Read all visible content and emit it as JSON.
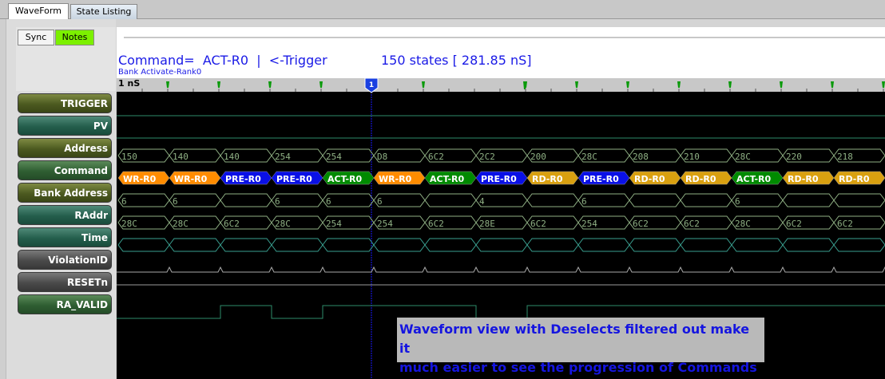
{
  "tabs": [
    {
      "label": "WaveForm",
      "active": true
    },
    {
      "label": "State Listing",
      "active": false
    }
  ],
  "toolbar": {
    "sync_label": "Sync",
    "notes_label": "Notes",
    "notes_color": "#7cf000"
  },
  "header": {
    "command_label": "Command=",
    "command_value": "ACT-R0",
    "separator": "|",
    "trigger_label": "<-Trigger",
    "states_text": "150 states [ 281.85 nS]",
    "bank_text": "Bank Activate-Rank0"
  },
  "timescale": {
    "scale_label": "1 nS",
    "cursor_label": "1"
  },
  "signals": [
    {
      "name": "TRIGGER",
      "color": "olive"
    },
    {
      "name": "PV",
      "color": "teal"
    },
    {
      "name": "Address",
      "color": "olive"
    },
    {
      "name": "Command",
      "color": "green"
    },
    {
      "name": "Bank Address",
      "color": "olive"
    },
    {
      "name": "RAddr",
      "color": "teal"
    },
    {
      "name": "Time",
      "color": "teal"
    },
    {
      "name": "ViolationID",
      "color": "gray"
    },
    {
      "name": "RESETn",
      "color": "gray"
    },
    {
      "name": "RA_VALID",
      "color": "green"
    }
  ],
  "waves": {
    "address": [
      "150",
      "140",
      "140",
      "254",
      "254",
      "D8",
      "6C2",
      "2C2",
      "200",
      "28C",
      "208",
      "210",
      "28C",
      "220",
      "218"
    ],
    "command": [
      "WR-R0",
      "WR-R0",
      "PRE-R0",
      "PRE-R0",
      "ACT-R0",
      "WR-R0",
      "ACT-R0",
      "PRE-R0",
      "RD-R0",
      "PRE-R0",
      "RD-R0",
      "RD-R0",
      "ACT-R0",
      "RD-R0",
      "RD-R0"
    ],
    "bank_address": [
      "6",
      "6",
      "",
      "6",
      "6",
      "6",
      "",
      "4",
      "",
      "6",
      "",
      "",
      "6",
      "",
      ""
    ],
    "raddr": [
      "28C",
      "28C",
      "6C2",
      "28C",
      "254",
      "254",
      "6C2",
      "28E",
      "6C2",
      "254",
      "6C2",
      "6C2",
      "28C",
      "6C2",
      "6C2"
    ],
    "ra_valid": [
      0,
      0,
      1,
      0,
      1,
      1,
      1,
      0,
      1,
      1,
      1,
      1,
      1,
      1,
      1
    ]
  },
  "command_colors": {
    "WR-R0": "#ff8c00",
    "PRE-R0": "#0a10e6",
    "ACT-R0": "#008a00",
    "RD-R0": "#d9a010"
  },
  "annotation": {
    "line1": "Waveform view with Deselects filtered out make it",
    "line2": "much easier to see the progression of Commands"
  }
}
